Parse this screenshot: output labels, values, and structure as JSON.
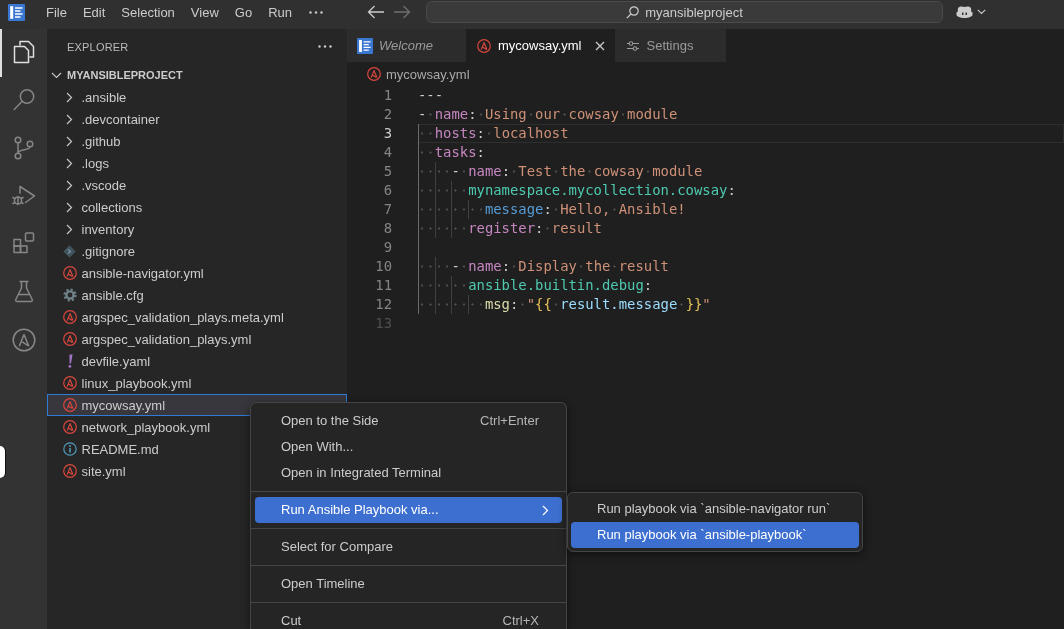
{
  "title_bar": {
    "menu": [
      "File",
      "Edit",
      "Selection",
      "View",
      "Go",
      "Run"
    ],
    "navigation": [
      {
        "kind": "back",
        "disabled": false
      },
      {
        "kind": "forward",
        "disabled": true
      }
    ],
    "command_center": "myansibleproject"
  },
  "activity_bar": {
    "items": [
      {
        "kind": "explorer",
        "selected": true
      },
      {
        "kind": "search",
        "selected": false
      },
      {
        "kind": "source_control",
        "selected": false
      },
      {
        "kind": "run_debug",
        "selected": false
      },
      {
        "kind": "extensions",
        "selected": false
      },
      {
        "kind": "testing",
        "selected": false
      },
      {
        "kind": "ansible",
        "selected": false
      }
    ]
  },
  "explorer": {
    "title": "EXPLORER",
    "root": {
      "name": "MYANSIBLEPROJECT",
      "expanded": true,
      "children": [
        {
          "name": ".ansible",
          "kind": "folder",
          "expanded": false,
          "selected": false
        },
        {
          "name": ".devcontainer",
          "kind": "folder",
          "expanded": false,
          "selected": false
        },
        {
          "name": ".github",
          "kind": "folder",
          "expanded": false,
          "selected": false
        },
        {
          "name": ".logs",
          "kind": "folder",
          "expanded": false,
          "selected": false
        },
        {
          "name": ".vscode",
          "kind": "folder",
          "expanded": false,
          "selected": false
        },
        {
          "name": "collections",
          "kind": "folder",
          "expanded": false,
          "selected": false
        },
        {
          "name": "inventory",
          "kind": "folder",
          "expanded": false,
          "selected": false
        },
        {
          "name": ".gitignore",
          "kind": "git",
          "selected": false
        },
        {
          "name": "ansible-navigator.yml",
          "kind": "ansible",
          "selected": false
        },
        {
          "name": "ansible.cfg",
          "kind": "config",
          "selected": false
        },
        {
          "name": "argspec_validation_plays.meta.yml",
          "kind": "ansible",
          "selected": false
        },
        {
          "name": "argspec_validation_plays.yml",
          "kind": "ansible",
          "selected": false
        },
        {
          "name": "devfile.yaml",
          "kind": "yaml",
          "selected": false
        },
        {
          "name": "linux_playbook.yml",
          "kind": "ansible",
          "selected": false
        },
        {
          "name": "mycowsay.yml",
          "kind": "ansible",
          "selected": true
        },
        {
          "name": "network_playbook.yml",
          "kind": "ansible",
          "selected": false
        },
        {
          "name": "README.md",
          "kind": "info",
          "selected": false
        },
        {
          "name": "site.yml",
          "kind": "ansible",
          "selected": false
        }
      ]
    }
  },
  "tabs": [
    {
      "label": "Welcome",
      "kind": "welcome",
      "preview": true,
      "selected": false
    },
    {
      "label": "mycowsay.yml",
      "kind": "ansible",
      "preview": false,
      "selected": true
    },
    {
      "label": "Settings",
      "kind": "settings",
      "preview": false,
      "selected": false
    }
  ],
  "breadcrumb": {
    "label": "mycowsay.yml",
    "kind": "ansible"
  },
  "editor": {
    "lines": [
      {
        "number": "1",
        "active": false,
        "dimmed": false,
        "tokens": [
          {
            "text": "---",
            "kind": "plain"
          }
        ]
      },
      {
        "number": "2",
        "active": false,
        "dimmed": false,
        "tokens": [
          {
            "text": "- ",
            "kind": "plain"
          },
          {
            "text": "name",
            "kind": "key"
          },
          {
            "text": ": ",
            "kind": "plain"
          },
          {
            "text": "Using our cowsay module",
            "kind": "string"
          }
        ]
      },
      {
        "number": "3",
        "active": true,
        "dimmed": false,
        "tokens": [
          {
            "text": "  hosts",
            "kind": "key"
          },
          {
            "text": ": ",
            "kind": "plain"
          },
          {
            "text": "localhost",
            "kind": "string"
          }
        ]
      },
      {
        "number": "4",
        "active": false,
        "dimmed": false,
        "tokens": [
          {
            "text": "  tasks",
            "kind": "key"
          },
          {
            "text": ":",
            "kind": "plain"
          }
        ]
      },
      {
        "number": "5",
        "active": false,
        "dimmed": false,
        "tokens": [
          {
            "text": "    - ",
            "kind": "plain"
          },
          {
            "text": "name",
            "kind": "key"
          },
          {
            "text": ": ",
            "kind": "plain"
          },
          {
            "text": "Test the cowsay module",
            "kind": "string"
          }
        ]
      },
      {
        "number": "6",
        "active": false,
        "dimmed": false,
        "tokens": [
          {
            "text": "      mynamespace.mycollection.cowsay",
            "kind": "module"
          },
          {
            "text": ":",
            "kind": "plain"
          }
        ]
      },
      {
        "number": "7",
        "active": false,
        "dimmed": false,
        "tokens": [
          {
            "text": "        message",
            "kind": "param"
          },
          {
            "text": ": ",
            "kind": "plain"
          },
          {
            "text": "Hello, Ansible!",
            "kind": "string"
          }
        ]
      },
      {
        "number": "8",
        "active": false,
        "dimmed": false,
        "tokens": [
          {
            "text": "      register",
            "kind": "key"
          },
          {
            "text": ": ",
            "kind": "plain"
          },
          {
            "text": "result",
            "kind": "string"
          }
        ]
      },
      {
        "number": "9",
        "active": false,
        "dimmed": false
      },
      {
        "number": "10",
        "active": false,
        "dimmed": false,
        "tokens": [
          {
            "text": "    - ",
            "kind": "plain"
          },
          {
            "text": "name",
            "kind": "key"
          },
          {
            "text": ": ",
            "kind": "plain"
          },
          {
            "text": "Display the result",
            "kind": "string"
          }
        ]
      },
      {
        "number": "11",
        "active": false,
        "dimmed": false,
        "tokens": [
          {
            "text": "      ansible.builtin.debug",
            "kind": "module"
          },
          {
            "text": ":",
            "kind": "plain"
          }
        ]
      },
      {
        "number": "12",
        "active": false,
        "dimmed": false,
        "tokens": [
          {
            "text": "        msg",
            "kind": "func"
          },
          {
            "text": ": ",
            "kind": "plain"
          },
          {
            "text": "\"",
            "kind": "string"
          },
          {
            "text": "{{ ",
            "kind": "bracket"
          },
          {
            "text": "result.message ",
            "kind": "var"
          },
          {
            "text": "}}",
            "kind": "bracket"
          },
          {
            "text": "\"",
            "kind": "string"
          }
        ]
      },
      {
        "number": "13",
        "active": false,
        "dimmed": true
      }
    ]
  },
  "context_menu": {
    "groups": [
      {
        "items": [
          {
            "label": "Open to the Side",
            "shortcut": "Ctrl+Enter",
            "selected": false
          },
          {
            "label": "Open With...",
            "selected": false
          },
          {
            "label": "Open in Integrated Terminal",
            "selected": false
          }
        ]
      },
      {
        "items": [
          {
            "label": "Run Ansible Playbook via...",
            "selected": true,
            "submenu": [
              {
                "label": "Run playbook via `ansible-navigator run`",
                "selected": false
              },
              {
                "label": "Run playbook via `ansible-playbook`",
                "selected": true
              }
            ]
          }
        ]
      },
      {
        "items": [
          {
            "label": "Select for Compare",
            "selected": false
          }
        ]
      },
      {
        "items": [
          {
            "label": "Open Timeline",
            "selected": false
          }
        ]
      },
      {
        "items": [
          {
            "label": "Cut",
            "shortcut": "Ctrl+X",
            "selected": false
          }
        ]
      }
    ]
  }
}
